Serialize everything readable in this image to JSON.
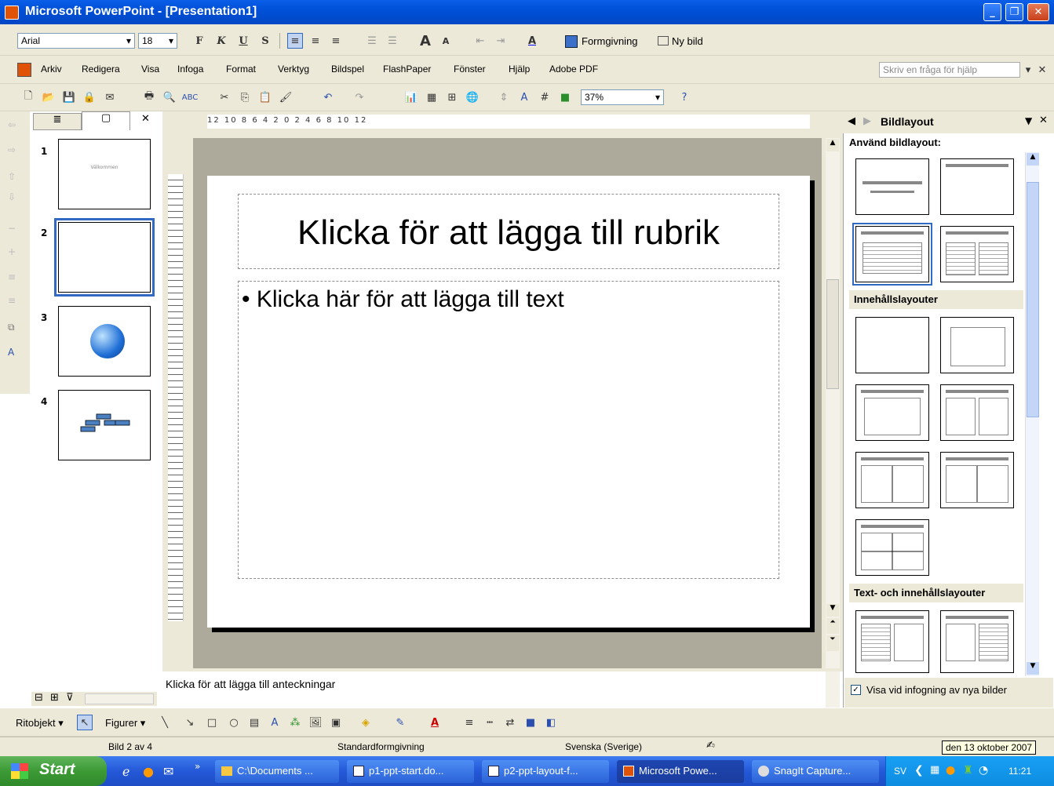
{
  "window": {
    "title": "Microsoft PowerPoint - [Presentation1]",
    "app_icon": "powerpoint-icon"
  },
  "format_bar": {
    "font": "Arial",
    "size": "18",
    "bold": "F",
    "italic": "K",
    "underline": "U",
    "shadow": "S",
    "design_label": "Formgivning",
    "new_slide_label": "Ny bild"
  },
  "menu": {
    "items": [
      "Arkiv",
      "Redigera",
      "Visa",
      "Infoga",
      "Format",
      "Verktyg",
      "Bildspel",
      "FlashPaper",
      "Fönster",
      "Hjälp",
      "Adobe PDF"
    ],
    "help_placeholder": "Skriv en fråga för hjälp"
  },
  "standard_bar": {
    "zoom": "37%"
  },
  "ruler": {
    "labels": "12 10 8 6 4 2 0 2 4 6 8 10 12"
  },
  "slides": [
    {
      "num": "1",
      "thumb_text": "Välkommen"
    },
    {
      "num": "2"
    },
    {
      "num": "3",
      "icon": "globe-icon"
    },
    {
      "num": "4",
      "icon": "org-chart-icon"
    }
  ],
  "slide": {
    "title_placeholder": "Klicka för att lägga till rubrik",
    "bullet": "•",
    "body_placeholder": "Klicka här för att lägga till text"
  },
  "notes": {
    "placeholder": "Klicka för att lägga till anteckningar"
  },
  "taskpane": {
    "title": "Bildlayout",
    "apply_label": "Använd bildlayout:",
    "section_content": "Innehållslayouter",
    "section_text_content": "Text- och innehållslayouter",
    "show_on_insert": "Visa vid infogning av nya bilder"
  },
  "drawing_bar": {
    "draw_label": "Ritobjekt",
    "shapes_label": "Figurer"
  },
  "status": {
    "slide_pos": "Bild 2 av 4",
    "design": "Standardformgivning",
    "language": "Svenska (Sverige)",
    "date_tooltip": "den 13 oktober 2007"
  },
  "taskbar": {
    "start": "Start",
    "buttons": [
      "C:\\Documents ...",
      "p1-ppt-start.do...",
      "p2-ppt-layout-f...",
      "Microsoft Powe...",
      "SnagIt Capture..."
    ],
    "lang": "SV",
    "clock": "11:21"
  }
}
